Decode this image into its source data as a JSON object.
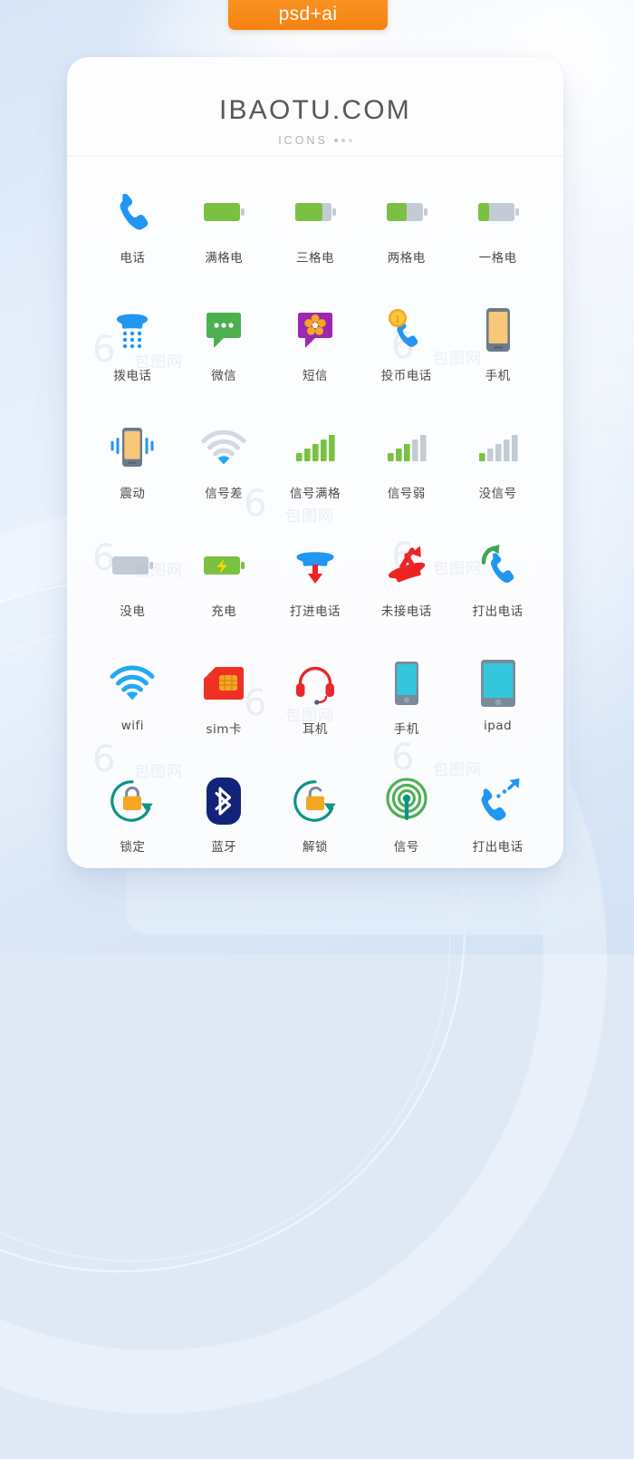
{
  "badge": {
    "label": "psd+ai"
  },
  "header": {
    "title": "IBAOTU.COM",
    "subtitle": "ICONS"
  },
  "watermark": {
    "mark": "包图网"
  },
  "colors": {
    "page_bg": "#dfe9f6",
    "card_bg": "#fcfdfe",
    "badge_orange": "#f58113",
    "title_gray": "#575757",
    "label_gray": "#4a4a4a",
    "blue": "#2196f3",
    "green": "#7ac143",
    "gray": "#c3ccd4",
    "red": "#ef2222",
    "purple": "#9c27b0",
    "orange": "#f5a623",
    "teal": "#0e9384",
    "cyan": "#33c6dd"
  },
  "grid": {
    "columns": 5,
    "rows": 6,
    "icons": [
      {
        "id": "phone",
        "label": "电话",
        "icon": "phone-handset-icon"
      },
      {
        "id": "battery-full",
        "label": "满格电",
        "icon": "battery-full-icon"
      },
      {
        "id": "battery-three",
        "label": "三格电",
        "icon": "battery-three-quarter-icon"
      },
      {
        "id": "battery-two",
        "label": "两格电",
        "icon": "battery-half-icon"
      },
      {
        "id": "battery-one",
        "label": "一格电",
        "icon": "battery-low-icon"
      },
      {
        "id": "dial-phone",
        "label": "拨电话",
        "icon": "dial-pad-phone-icon"
      },
      {
        "id": "wechat",
        "label": "微信",
        "icon": "chat-bubble-icon"
      },
      {
        "id": "sms",
        "label": "短信",
        "icon": "message-flower-icon"
      },
      {
        "id": "payphone",
        "label": "投币电话",
        "icon": "coin-phone-icon"
      },
      {
        "id": "mobile-orange",
        "label": "手机",
        "icon": "smartphone-orange-icon"
      },
      {
        "id": "vibrate",
        "label": "震动",
        "icon": "vibrate-phone-icon"
      },
      {
        "id": "signal-poor",
        "label": "信号差",
        "icon": "wifi-weak-icon"
      },
      {
        "id": "signal-full",
        "label": "信号满格",
        "icon": "signal-bars-full-icon"
      },
      {
        "id": "signal-weak",
        "label": "信号弱",
        "icon": "signal-bars-weak-icon"
      },
      {
        "id": "no-signal",
        "label": "没信号",
        "icon": "signal-bars-none-icon"
      },
      {
        "id": "battery-empty",
        "label": "没电",
        "icon": "battery-empty-icon"
      },
      {
        "id": "charging",
        "label": "充电",
        "icon": "battery-charging-icon"
      },
      {
        "id": "call-incoming",
        "label": "打进电话",
        "icon": "call-incoming-icon"
      },
      {
        "id": "call-missed",
        "label": "未接电话",
        "icon": "call-missed-icon"
      },
      {
        "id": "call-outgoing",
        "label": "打出电话",
        "icon": "call-outgoing-icon"
      },
      {
        "id": "wifi",
        "label": "wifi",
        "icon": "wifi-full-icon"
      },
      {
        "id": "sim",
        "label": "sim卡",
        "icon": "sim-card-icon"
      },
      {
        "id": "headset",
        "label": "耳机",
        "icon": "headset-icon"
      },
      {
        "id": "mobile-cyan",
        "label": "手机",
        "icon": "smartphone-cyan-icon"
      },
      {
        "id": "ipad",
        "label": "ipad",
        "icon": "tablet-icon"
      },
      {
        "id": "lock",
        "label": "锁定",
        "icon": "lock-closed-icon"
      },
      {
        "id": "bluetooth",
        "label": "蓝牙",
        "icon": "bluetooth-icon"
      },
      {
        "id": "unlock",
        "label": "解锁",
        "icon": "lock-open-icon"
      },
      {
        "id": "signal",
        "label": "信号",
        "icon": "broadcast-tower-icon"
      },
      {
        "id": "call-out-2",
        "label": "打出电话",
        "icon": "call-outgoing-arrow-icon"
      }
    ]
  }
}
